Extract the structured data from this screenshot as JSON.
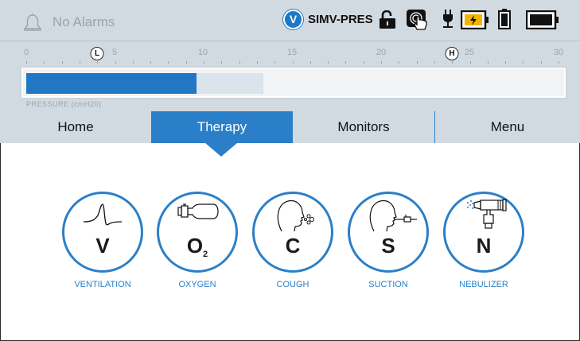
{
  "status": {
    "alarm_text": "No Alarms",
    "mode_badge": "V",
    "mode_text": "SIMV-PRES"
  },
  "scale": {
    "ticks": [
      "0",
      "5",
      "10",
      "15",
      "20",
      "25",
      "30"
    ],
    "low_marker": "L",
    "high_marker": "H",
    "label": "PRESSURE (cmH20)"
  },
  "pressure": {
    "range_max": 30,
    "current_value": 8.7,
    "peak_value": 13.5
  },
  "tabs": [
    {
      "label": "Home"
    },
    {
      "label": "Therapy"
    },
    {
      "label": "Monitors"
    },
    {
      "label": "Menu"
    }
  ],
  "therapies": [
    {
      "letter": "V",
      "caption": "VENTILATION"
    },
    {
      "letter": "O",
      "subscript": "2",
      "caption": "OXYGEN"
    },
    {
      "letter": "C",
      "caption": "COUGH"
    },
    {
      "letter": "S",
      "caption": "SUCTION"
    },
    {
      "letter": "N",
      "caption": "NEBULIZER"
    }
  ],
  "colors": {
    "accent": "#2a7fc8",
    "header_bg": "#d2dae1",
    "battery_charge": "#f2b600"
  },
  "icons": [
    "bell-icon",
    "lock-open-icon",
    "touch-screen-icon",
    "power-plug-icon",
    "battery-charging-icon",
    "battery-removable-icon",
    "battery-internal-icon"
  ]
}
